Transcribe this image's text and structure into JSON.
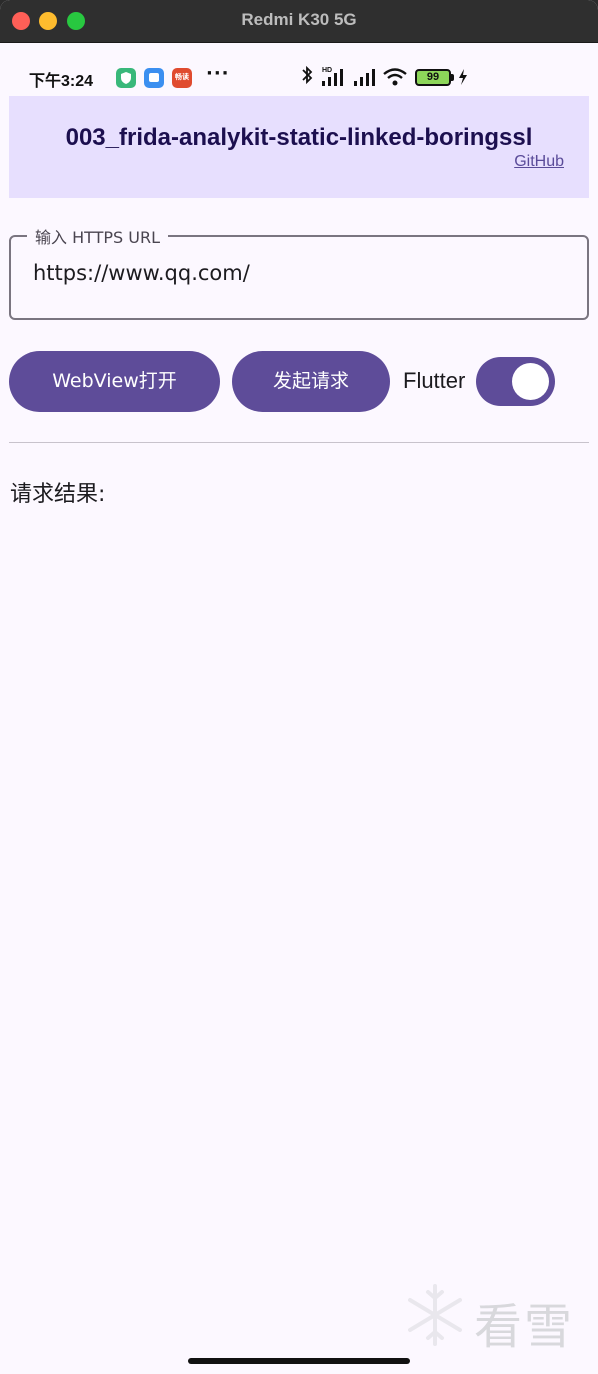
{
  "window": {
    "title": "Redmi K30 5G"
  },
  "statusbar": {
    "time": "下午3:24",
    "dots": "···",
    "battery": "99",
    "app3_label": "畅读"
  },
  "app": {
    "title": "003_frida-analykit-static-linked-boringssl",
    "link": "GitHub"
  },
  "url_field": {
    "label": "输入 HTTPS URL",
    "value": "https://www.qq.com/"
  },
  "buttons": {
    "webview": "WebView打开",
    "request": "发起请求"
  },
  "flutter_switch": {
    "label": "Flutter",
    "on": true
  },
  "result": {
    "label": "请求结果:"
  },
  "watermark": {
    "text": "看雪"
  },
  "colors": {
    "primary": "#5e4c99",
    "header_bg": "#e7dffe",
    "title_text": "#1c0f4f",
    "background": "#fcf8ff"
  }
}
